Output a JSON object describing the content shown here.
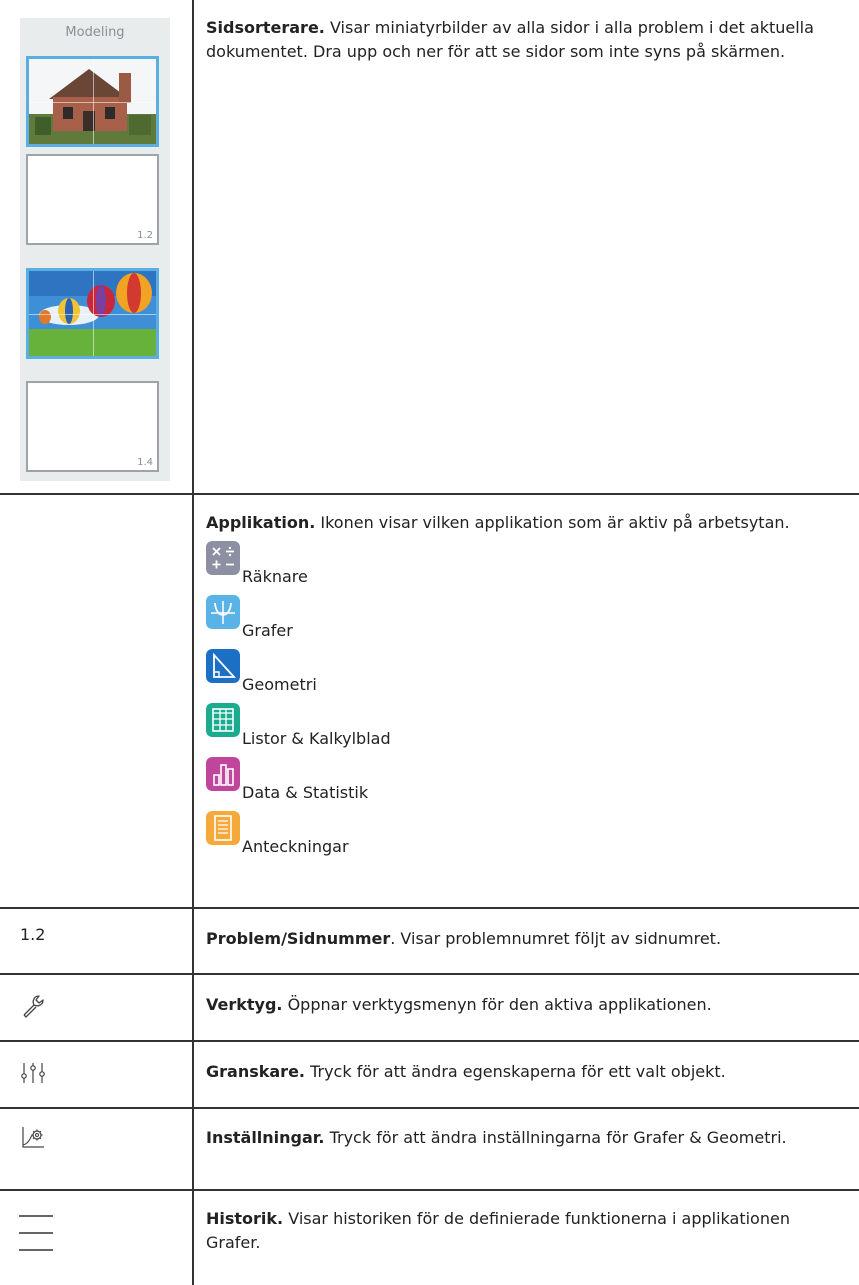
{
  "page_sorter": {
    "header": "Modeling",
    "pages": [
      {
        "number": "",
        "thumbnail": "house-photo"
      },
      {
        "number": "1.2",
        "thumbnail": "blank"
      },
      {
        "number": "",
        "thumbnail": "hot-air-balloons-photo"
      },
      {
        "number": "1.4",
        "thumbnail": "blank"
      }
    ]
  },
  "rows": {
    "sorter": {
      "term": "Sidsorterare.",
      "text": " Visar miniatyrbilder av alla sidor i alla problem i det aktuella dokumentet. Dra upp och ner för att se sidor som inte syns på skärmen."
    },
    "application": {
      "term": "Applikation.",
      "text": " Ikonen visar vilken applikation som är aktiv på arbetsytan.",
      "apps": [
        {
          "label": "Räknare",
          "icon": "calculator-icon",
          "color": "#8d8fa3"
        },
        {
          "label": "Grafer",
          "icon": "graphs-icon",
          "color": "#5ab3e6"
        },
        {
          "label": "Geometri",
          "icon": "geometry-icon",
          "color": "#1b6fc4"
        },
        {
          "label": "Listor &  Kalkylblad",
          "icon": "lists-spreadsheet-icon",
          "color": "#1bab8f"
        },
        {
          "label": "Data &  Statistik",
          "icon": "data-statistics-icon",
          "color": "#c0469c"
        },
        {
          "label": "Anteckningar",
          "icon": "notes-icon",
          "color": "#f6a93b"
        }
      ]
    },
    "page_number": {
      "left": "1.2",
      "term": "Problem/Sidnummer",
      "text": ". Visar problemnumret följt av sidnumret."
    },
    "tools": {
      "icon": "wrench-icon",
      "term": "Verktyg.",
      "text": " Öppnar verktygsmenyn för den aktiva applikationen."
    },
    "inspector": {
      "icon": "inspector-sliders-icon",
      "term": "Granskare.",
      "text": " Tryck för att ändra egenskaperna för ett valt objekt."
    },
    "settings": {
      "icon": "graph-settings-icon",
      "term": "Inställningar.",
      "text": " Tryck för att ändra inställningarna för Grafer & Geometri."
    },
    "history": {
      "icon": "history-menu-icon",
      "term": "Historik.",
      "text": " Visar historiken för de definierade funktionerna i applikationen Grafer."
    }
  }
}
